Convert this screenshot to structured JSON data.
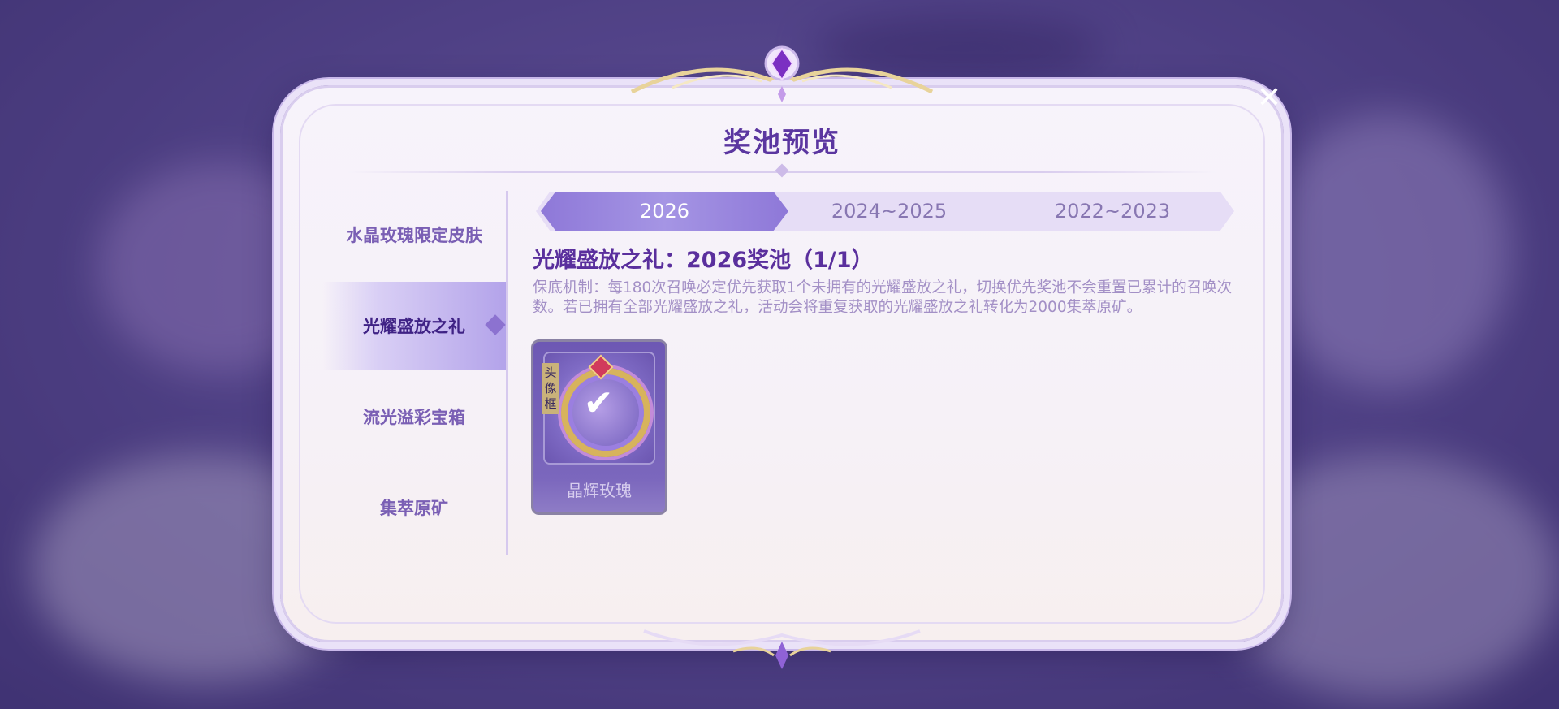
{
  "dialog": {
    "title": "奖池预览",
    "close_label": "✕"
  },
  "sidebar": {
    "items": [
      {
        "label": "水晶玫瑰限定皮肤",
        "active": false
      },
      {
        "label": "光耀盛放之礼",
        "active": true
      },
      {
        "label": "流光溢彩宝箱",
        "active": false
      },
      {
        "label": "集萃原矿",
        "active": false
      }
    ]
  },
  "tabs": [
    {
      "label": "2026",
      "active": true
    },
    {
      "label": "2024~2025",
      "active": false
    },
    {
      "label": "2022~2023",
      "active": false
    }
  ],
  "pool": {
    "title": "光耀盛放之礼：2026奖池（1/1）",
    "description": "保底机制：每180次召唤必定优先获取1个未拥有的光耀盛放之礼，切换优先奖池不会重置已累计的召唤次数。若已拥有全部光耀盛放之礼，活动会将重复获取的光耀盛放之礼转化为2000集萃原矿。"
  },
  "reward_card": {
    "tag": "头像框",
    "name": "晶辉玫瑰",
    "owned_icon": "checkmark-icon"
  },
  "colors": {
    "accent": "#5b36a0",
    "tab_active": "#8e78d8",
    "panel": "#f7f3fb"
  }
}
